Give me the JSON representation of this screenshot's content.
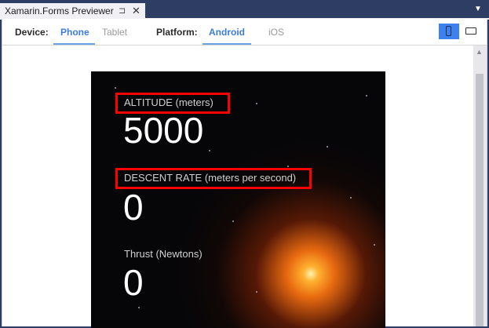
{
  "window": {
    "tab_title": "Xamarin.Forms Previewer",
    "pin_glyph": "⊐",
    "close_glyph": "✕",
    "dropdown_glyph": "▼"
  },
  "toolbar": {
    "device_label": "Device:",
    "device_options": [
      "Phone",
      "Tablet"
    ],
    "device_selected": "Phone",
    "platform_label": "Platform:",
    "platform_options": [
      "Android",
      "iOS"
    ],
    "platform_selected": "Android",
    "orientation": [
      "portrait",
      "landscape"
    ],
    "orientation_selected": "portrait"
  },
  "preview": {
    "fields": [
      {
        "label": "ALTITUDE (meters)",
        "value": "5000",
        "highlighted": true
      },
      {
        "label": "DESCENT RATE (meters per second)",
        "value": "0",
        "highlighted": true
      },
      {
        "label": "Thrust (Newtons)",
        "value": "0",
        "highlighted": false
      }
    ]
  },
  "colors": {
    "accent": "#3b7ddb",
    "highlight_box": "#ff0000",
    "chrome": "#2e3d63"
  },
  "icons": {
    "scroll_up": "▲"
  }
}
